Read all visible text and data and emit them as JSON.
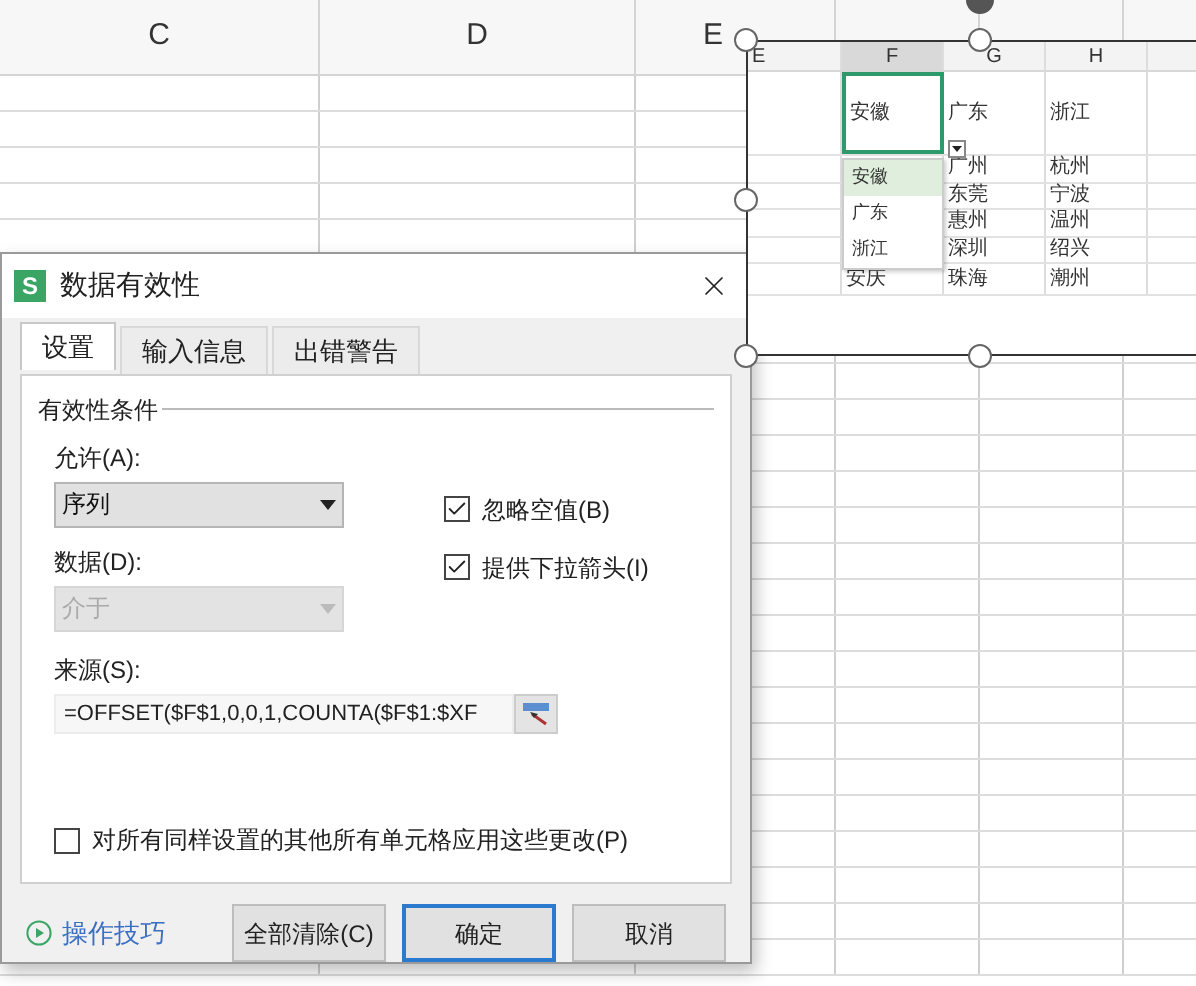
{
  "sheet": {
    "columns": [
      {
        "label": "C",
        "selected": false
      },
      {
        "label": "D",
        "selected": false
      },
      {
        "label": "E",
        "selected": false
      }
    ]
  },
  "embedded_picture": {
    "columns": [
      "E",
      "F",
      "G",
      "H"
    ],
    "rows": [
      {
        "f": "安徽",
        "g": "广东",
        "h": "浙江",
        "f_selected": true
      },
      {
        "g": "广州",
        "h": "杭州"
      },
      {
        "g": "东莞",
        "h": "宁波"
      },
      {
        "g": "惠州",
        "h": "温州"
      },
      {
        "g": "深圳",
        "h": "绍兴"
      },
      {
        "f": "安庆",
        "g": "珠海",
        "h": "潮州",
        "f_selected": false
      }
    ],
    "dropdown": {
      "items": [
        {
          "label": "安徽",
          "selected": true
        },
        {
          "label": "广东",
          "selected": false
        },
        {
          "label": "浙江",
          "selected": false
        }
      ]
    }
  },
  "dialog": {
    "icon_letter": "S",
    "title": "数据有效性",
    "tabs": [
      {
        "label": "设置",
        "selected": true
      },
      {
        "label": "输入信息",
        "selected": false
      },
      {
        "label": "出错警告",
        "selected": false
      }
    ],
    "group_title": "有效性条件",
    "allow": {
      "label": "允许(A):",
      "value": "序列",
      "disabled": false
    },
    "data": {
      "label": "数据(D):",
      "value": "介于",
      "disabled": true
    },
    "options": [
      {
        "label": "忽略空值(B)",
        "checked": true
      },
      {
        "label": "提供下拉箭头(I)",
        "checked": true
      }
    ],
    "source": {
      "label": "来源(S):",
      "value": "=OFFSET($F$1,0,0,1,COUNTA($F$1:$XF"
    },
    "apply_all": {
      "label": "对所有同样设置的其他所有单元格应用这些更改(P)",
      "checked": false
    },
    "tips_link": "操作技巧",
    "buttons": [
      {
        "label": "全部清除(C)",
        "default": false
      },
      {
        "label": "确定",
        "default": true
      },
      {
        "label": "取消",
        "default": false
      }
    ]
  }
}
